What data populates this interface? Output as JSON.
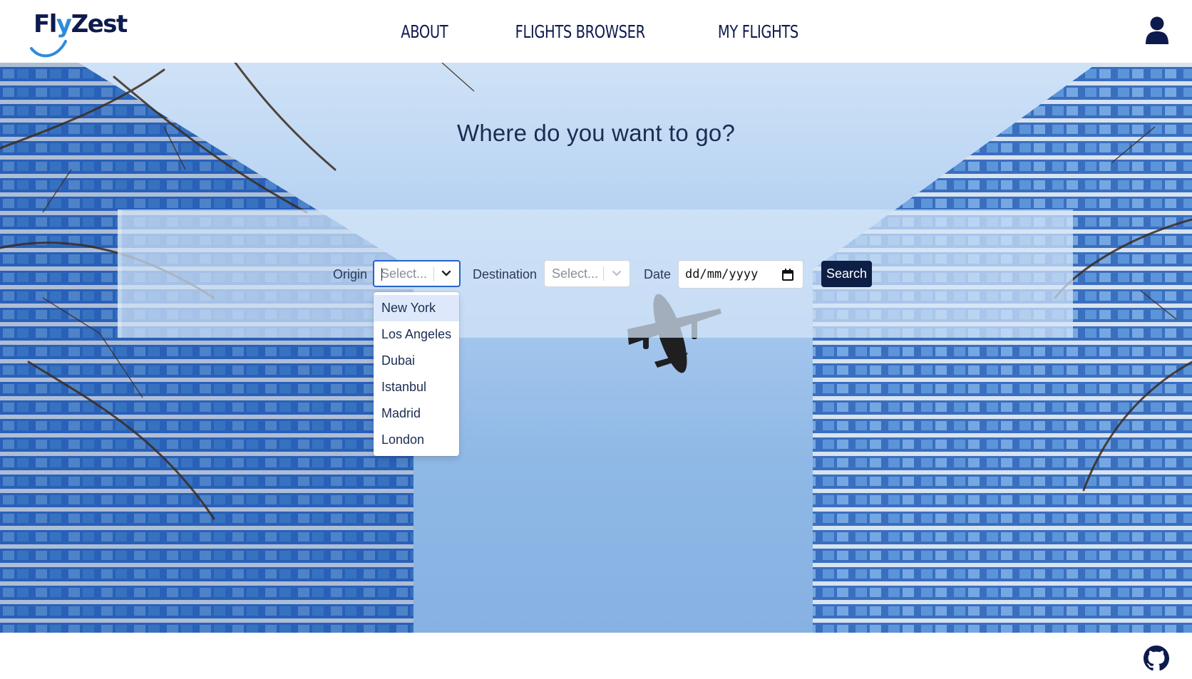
{
  "brand": {
    "name_part1": "Fl",
    "name_y": "y",
    "name_part2": "Zest"
  },
  "nav": {
    "items": [
      {
        "label": "ABOUT"
      },
      {
        "label": "FLIGHTS BROWSER"
      },
      {
        "label": "MY FLIGHTS"
      }
    ]
  },
  "header": {
    "user_icon": "user-icon"
  },
  "hero": {
    "title": "Where do you want to go?"
  },
  "search": {
    "origin": {
      "label": "Origin",
      "placeholder": "Select...",
      "open": true
    },
    "destination": {
      "label": "Destination",
      "placeholder": "Select..."
    },
    "date": {
      "label": "Date",
      "value": "dd/mm/yyyy"
    },
    "button_label": "Search"
  },
  "dropdown": {
    "options": [
      {
        "label": "New York",
        "active": true
      },
      {
        "label": "Los Angeles"
      },
      {
        "label": "Dubai"
      },
      {
        "label": "Istanbul"
      },
      {
        "label": "Madrid"
      },
      {
        "label": "London"
      }
    ]
  },
  "footer": {
    "icon": "github-icon"
  },
  "colors": {
    "brand_navy": "#0d1a4e",
    "accent_blue": "#2e8bdc",
    "button": "#0d1f45",
    "focus": "#2563c9"
  }
}
